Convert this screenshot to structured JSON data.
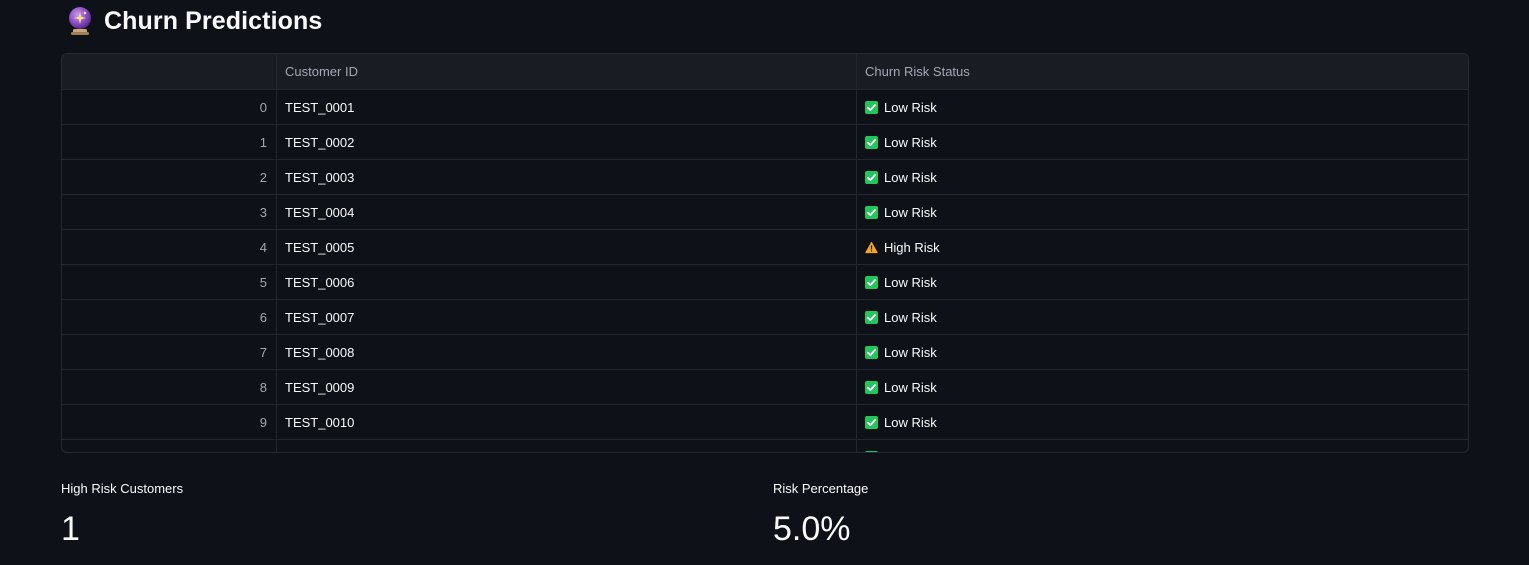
{
  "header": {
    "icon": "crystal-ball-icon",
    "title": "Churn Predictions"
  },
  "table": {
    "columns": [
      "",
      "Customer ID",
      "Churn Risk Status"
    ],
    "rows": [
      {
        "index": "0",
        "customer_id": "TEST_0001",
        "status": "Low Risk",
        "status_icon": "check-mark-icon"
      },
      {
        "index": "1",
        "customer_id": "TEST_0002",
        "status": "Low Risk",
        "status_icon": "check-mark-icon"
      },
      {
        "index": "2",
        "customer_id": "TEST_0003",
        "status": "Low Risk",
        "status_icon": "check-mark-icon"
      },
      {
        "index": "3",
        "customer_id": "TEST_0004",
        "status": "Low Risk",
        "status_icon": "check-mark-icon"
      },
      {
        "index": "4",
        "customer_id": "TEST_0005",
        "status": "High Risk",
        "status_icon": "warning-icon"
      },
      {
        "index": "5",
        "customer_id": "TEST_0006",
        "status": "Low Risk",
        "status_icon": "check-mark-icon"
      },
      {
        "index": "6",
        "customer_id": "TEST_0007",
        "status": "Low Risk",
        "status_icon": "check-mark-icon"
      },
      {
        "index": "7",
        "customer_id": "TEST_0008",
        "status": "Low Risk",
        "status_icon": "check-mark-icon"
      },
      {
        "index": "8",
        "customer_id": "TEST_0009",
        "status": "Low Risk",
        "status_icon": "check-mark-icon"
      },
      {
        "index": "9",
        "customer_id": "TEST_0010",
        "status": "Low Risk",
        "status_icon": "check-mark-icon"
      }
    ]
  },
  "metrics": {
    "high_risk": {
      "label": "High Risk Customers",
      "value": "1"
    },
    "risk_percentage": {
      "label": "Risk Percentage",
      "value": "5.0%"
    }
  },
  "colors": {
    "background": "#0e1117",
    "low_risk": "#22c55e",
    "high_risk": "#f5a623"
  }
}
